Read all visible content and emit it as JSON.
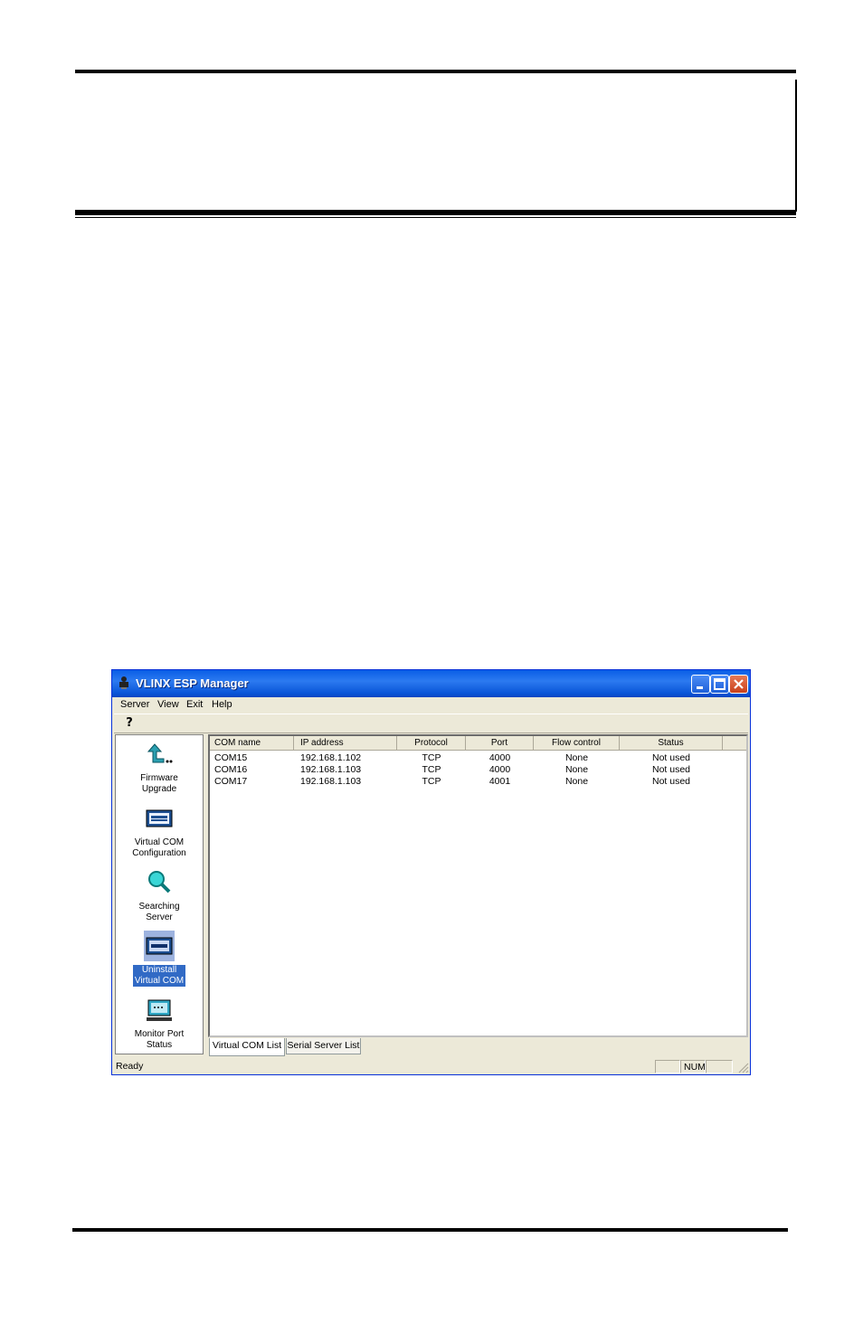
{
  "window": {
    "title": "VLINX ESP Manager",
    "title_color": "#0a5ee6"
  },
  "menu": [
    "Server",
    "View",
    "Exit",
    "Help"
  ],
  "toolbar": {
    "help_icon": "help-question-icon"
  },
  "nav": [
    {
      "label": "Firmware\nUpgrade",
      "icon": "firmware-upgrade-icon",
      "selected": false
    },
    {
      "label": "Virtual COM\nConfiguration",
      "icon": "virtual-com-icon",
      "selected": false
    },
    {
      "label": "Searching\nServer",
      "icon": "search-icon",
      "selected": false
    },
    {
      "label": "Uninstall\nVirtual COM",
      "icon": "uninstall-icon",
      "selected": true
    },
    {
      "label": "Monitor Port\nStatus",
      "icon": "monitor-icon",
      "selected": false
    }
  ],
  "table": {
    "columns": [
      "COM name",
      "IP address",
      "Protocol",
      "Port",
      "Flow control",
      "Status"
    ],
    "rows": [
      [
        "COM15",
        "192.168.1.102",
        "TCP",
        "4000",
        "None",
        "Not used"
      ],
      [
        "COM16",
        "192.168.1.103",
        "TCP",
        "4000",
        "None",
        "Not used"
      ],
      [
        "COM17",
        "192.168.1.103",
        "TCP",
        "4001",
        "None",
        "Not used"
      ]
    ]
  },
  "tabs": [
    "Virtual COM List",
    "Serial Server List"
  ],
  "status": {
    "text": "Ready",
    "num": "NUM"
  }
}
